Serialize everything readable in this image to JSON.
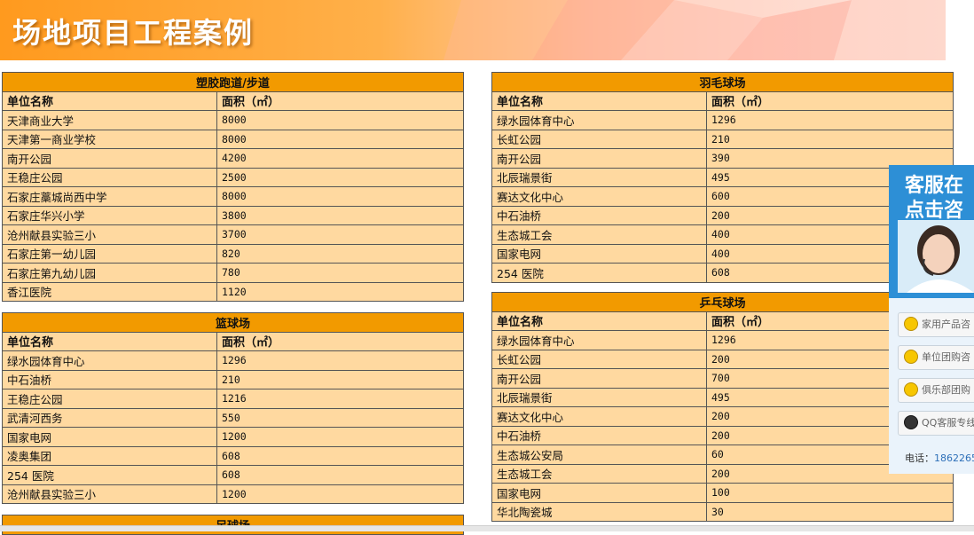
{
  "banner": {
    "title": "场地项目工程案例"
  },
  "tables": [
    {
      "caption": "塑胶跑道/步道",
      "headers": [
        "单位名称",
        "面积（㎡）"
      ],
      "rows": [
        [
          "天津商业大学",
          "8000"
        ],
        [
          "天津第一商业学校",
          "8000"
        ],
        [
          "南开公园",
          "4200"
        ],
        [
          "王稳庄公园",
          "2500"
        ],
        [
          "石家庄藁城尚西中学",
          "8000"
        ],
        [
          "石家庄华兴小学",
          "3800"
        ],
        [
          "沧州献县实验三小",
          "3700"
        ],
        [
          "石家庄第一幼儿园",
          "820"
        ],
        [
          "石家庄第九幼儿园",
          "780"
        ],
        [
          "香江医院",
          "1120"
        ]
      ]
    },
    {
      "caption": "篮球场",
      "headers": [
        "单位名称",
        "面积（㎡）"
      ],
      "rows": [
        [
          "绿水园体育中心",
          "1296"
        ],
        [
          "中石油桥",
          "210"
        ],
        [
          "王稳庄公园",
          "1216"
        ],
        [
          "武清河西务",
          "550"
        ],
        [
          "国家电网",
          "1200"
        ],
        [
          "凌奥集团",
          "608"
        ],
        [
          "254 医院",
          "608"
        ],
        [
          "沧州献县实验三小",
          "1200"
        ]
      ]
    },
    {
      "caption": "足球场",
      "headers": [],
      "rows": []
    },
    {
      "caption": "羽毛球场",
      "headers": [
        "单位名称",
        "面积（㎡）"
      ],
      "rows": [
        [
          "绿水园体育中心",
          "1296"
        ],
        [
          "长虹公园",
          "210"
        ],
        [
          "南开公园",
          "390"
        ],
        [
          "北辰瑞景街",
          "495"
        ],
        [
          "赛达文化中心",
          "600"
        ],
        [
          "中石油桥",
          "200"
        ],
        [
          "生态城工会",
          "400"
        ],
        [
          "国家电网",
          "400"
        ],
        [
          "254 医院",
          "608"
        ]
      ]
    },
    {
      "caption": "乒乓球场",
      "headers": [
        "单位名称",
        "面积（㎡）"
      ],
      "rows": [
        [
          "绿水园体育中心",
          "1296"
        ],
        [
          "长虹公园",
          "200"
        ],
        [
          "南开公园",
          "700"
        ],
        [
          "北辰瑞景街",
          "495"
        ],
        [
          "赛达文化中心",
          "200"
        ],
        [
          "中石油桥",
          "200"
        ],
        [
          "生态城公安局",
          "60"
        ],
        [
          "生态城工会",
          "200"
        ],
        [
          "国家电网",
          "100"
        ],
        [
          "华北陶瓷城",
          "30"
        ]
      ]
    }
  ],
  "cs_widget": {
    "title_line1": "客服在",
    "title_line2": "点击咨",
    "buttons": [
      "家用产品咨",
      "单位团购咨",
      "俱乐部团购",
      "QQ客服专线"
    ],
    "phone_label": "电话：",
    "phone_number": "1862265"
  },
  "colors": {
    "caption_bg": "#f29a00",
    "cell_bg": "#ffd9a0",
    "banner_accent": "#ff9a1e",
    "widget_blue": "#2d8fd6"
  }
}
